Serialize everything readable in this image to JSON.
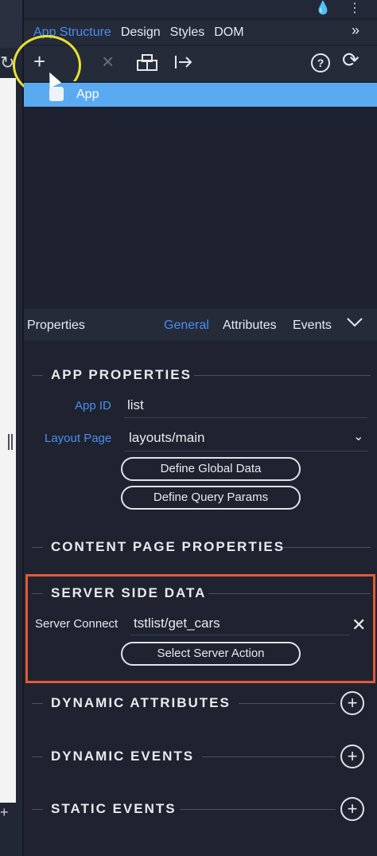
{
  "tabs": {
    "app_structure": "App Structure",
    "design": "Design",
    "styles": "Styles",
    "dom": "DOM",
    "more": "»"
  },
  "toolbar": {
    "add": "+",
    "remove": "×",
    "help": "?",
    "refresh": "⟳"
  },
  "tree": {
    "app_label": "App"
  },
  "properties": {
    "title": "Properties",
    "tab_general": "General",
    "tab_attributes": "Attributes",
    "tab_events": "Events"
  },
  "app_properties": {
    "section": "APP PROPERTIES",
    "app_id_label": "App ID",
    "app_id_value": "list",
    "layout_page_label": "Layout Page",
    "layout_page_value": "layouts/main",
    "define_global_data": "Define Global Data",
    "define_query_params": "Define Query Params"
  },
  "content_page_properties": {
    "section": "CONTENT PAGE PROPERTIES"
  },
  "server_side_data": {
    "section": "SERVER SIDE DATA",
    "server_connect_label": "Server Connect",
    "server_connect_value": "tstlist/get_cars",
    "select_server_action": "Select Server Action"
  },
  "dynamic_attributes": {
    "section": "DYNAMIC ATTRIBUTES"
  },
  "dynamic_events": {
    "section": "DYNAMIC EVENTS"
  },
  "static_events": {
    "section": "STATIC EVENTS"
  },
  "colors": {
    "accent": "#4a8ef0",
    "selection": "#5aaaf2",
    "highlight_circle": "#e6e331",
    "annotation_box": "#e25a36"
  }
}
